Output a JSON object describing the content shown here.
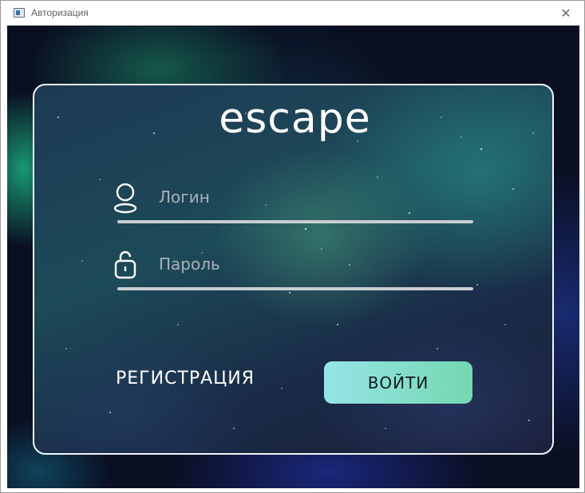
{
  "window": {
    "title": "Авторизация",
    "close_glyph": "✕"
  },
  "brand": {
    "logo_text": "escape"
  },
  "form": {
    "login_label": "Логин",
    "password_label": "Пароль",
    "register_label": "РЕГИСТРАЦИЯ",
    "submit_label": "ВОЙТИ"
  },
  "icons": {
    "user": "user-icon",
    "lock": "unlocked-icon",
    "app": "app-window-icon",
    "close": "close-icon"
  },
  "colors": {
    "button_gradient_start": "#96e4e6",
    "button_gradient_end": "#74d8b1",
    "card_border": "#f2f5f7",
    "field_line": "#c9ced2"
  }
}
